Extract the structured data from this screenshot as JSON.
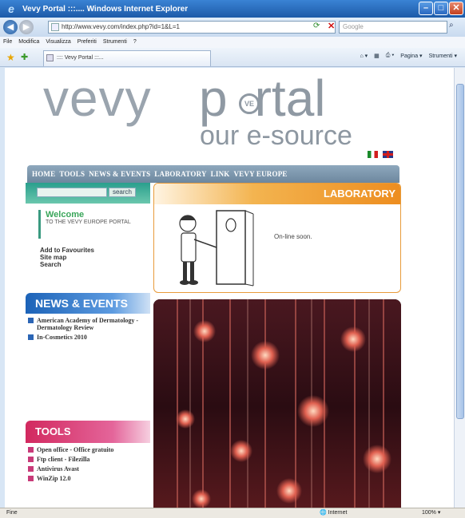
{
  "browser": {
    "window_title": "Vevy Portal :::.... Windows Internet Explorer",
    "address": "http://www.vevy.com/index.php?id=1&L=1",
    "search_placeholder": "Google",
    "menu": [
      "File",
      "Modifica",
      "Visualizza",
      "Preferiti",
      "Strumenti",
      "?"
    ],
    "tab_title": ":::: Vevy Portal :::...",
    "commands": [
      "Pagina",
      "Strumenti"
    ],
    "status_left": "Fine",
    "status_zone": "Internet",
    "status_zoom": "100%"
  },
  "site": {
    "logo_word": "vevy",
    "logo_p": "p",
    "logo_rest": "rtal",
    "logo_seal": "VE",
    "tagline": "our e-source",
    "nav": [
      "HOME",
      "TOOLS",
      "NEWS & EVENTS",
      "LABORATORY",
      "LINK",
      "VEVY EUROPE"
    ],
    "search_button": "search",
    "welcome_title": "Welcome",
    "welcome_sub": "TO THE VEVY EUROPE PORTAL",
    "quick_links": [
      "Add to Favourites",
      "Site map",
      "Search"
    ],
    "news_title": "NEWS & EVENTS",
    "news_items": [
      "American Academy of Dermatology - Dermatology Review",
      "In-Cosmetics 2010"
    ],
    "tools_title": "TOOLS",
    "tools_items": [
      "Open office - Office gratuito",
      "Ftp client - Filezilla",
      "Antivirus Avast",
      "WinZip 12.0"
    ],
    "lab_title": "LABORATORY",
    "lab_text": "On-line soon."
  },
  "colors": {
    "nav_bar": "#7f98ad",
    "news_accent": "#1c63b8",
    "tools_accent": "#d2295f",
    "lab_accent": "#ed8d1f",
    "welcome_green": "#3aa65a"
  }
}
